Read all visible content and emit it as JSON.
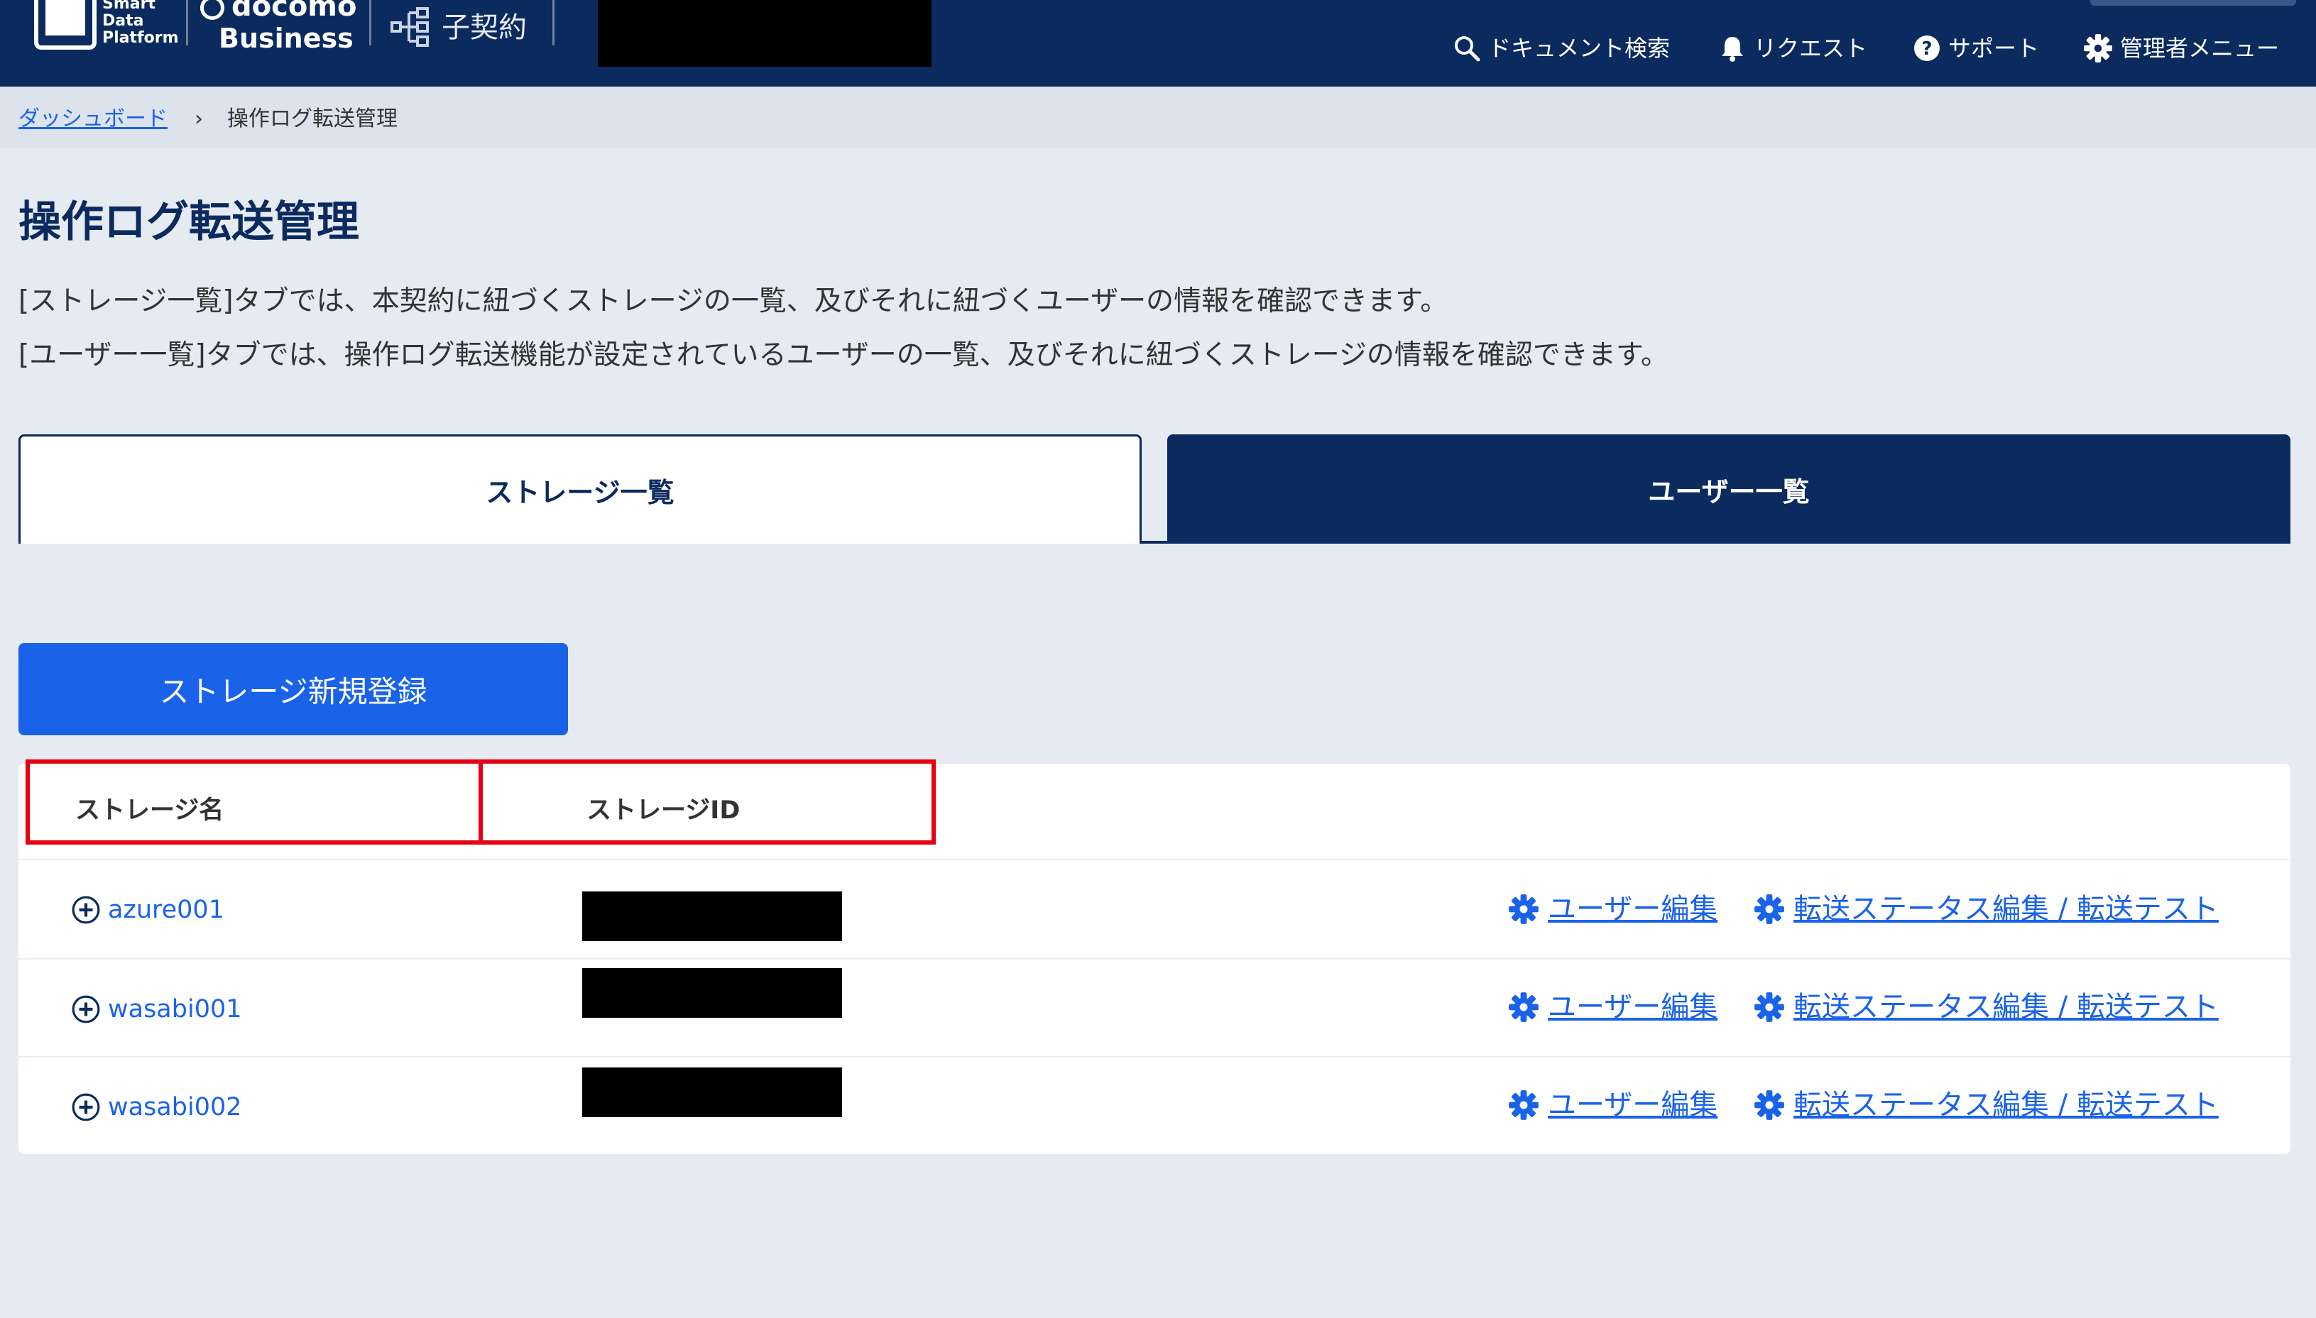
{
  "header": {
    "logo_line1": "Smart",
    "logo_line2": "Data",
    "logo_line3": "Platform",
    "brand_docomo": "docomo",
    "brand_business": "Business",
    "contract_label": "子契約",
    "nav": {
      "doc_search": "ドキュメント検索",
      "request": "リクエスト",
      "support": "サポート",
      "admin_menu": "管理者メニュー"
    }
  },
  "breadcrumb": {
    "home": "ダッシュボード",
    "separator": "›",
    "current": "操作ログ転送管理"
  },
  "page": {
    "title": "操作ログ転送管理",
    "desc1": "[ストレージ一覧]タブでは、本契約に紐づくストレージの一覧、及びそれに紐づくユーザーの情報を確認できます。",
    "desc2": "[ユーザー一覧]タブでは、操作ログ転送機能が設定されているユーザーの一覧、及びそれに紐づくストレージの情報を確認できます。"
  },
  "tabs": {
    "storage": "ストレージ一覧",
    "users": "ユーザー一覧"
  },
  "register_button": "ストレージ新規登録",
  "table": {
    "col_name": "ストレージ名",
    "col_id": "ストレージID",
    "rows": [
      {
        "name": "azure001",
        "edit_users": "ユーザー編集",
        "edit_transfer": "転送ステータス編集 / 転送テスト"
      },
      {
        "name": "wasabi001",
        "edit_users": "ユーザー編集",
        "edit_transfer": "転送ステータス編集 / 転送テスト"
      },
      {
        "name": "wasabi002",
        "edit_users": "ユーザー編集",
        "edit_transfer": "転送ステータス編集 / 転送テスト"
      }
    ]
  },
  "colors": {
    "navy": "#0b2a5e",
    "link_blue": "#1a63e8",
    "highlight_red": "#e60012",
    "page_bg": "#e6ebf2"
  }
}
